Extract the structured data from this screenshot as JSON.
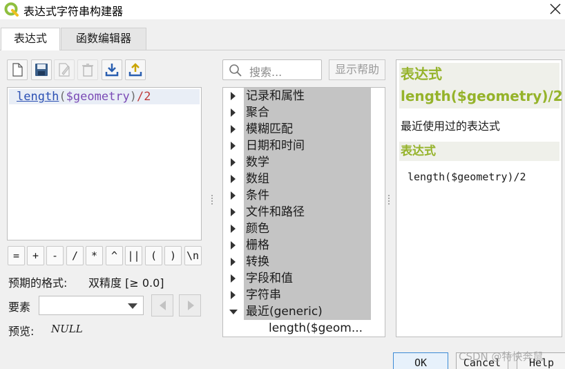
{
  "window": {
    "title": "表达式字符串构建器"
  },
  "tabs": [
    {
      "label": "表达式",
      "active": true
    },
    {
      "label": "函数编辑器",
      "active": false
    }
  ],
  "toolbar": {
    "buttons": [
      {
        "name": "new-file-icon"
      },
      {
        "name": "save-icon"
      },
      {
        "name": "edit-icon"
      },
      {
        "name": "delete-icon"
      },
      {
        "name": "import-icon"
      },
      {
        "name": "export-icon"
      }
    ]
  },
  "editor": {
    "tokens": {
      "fn": "length",
      "open": "(",
      "var": "$geometry",
      "close": ")",
      "op": "/2"
    }
  },
  "operators": [
    "=",
    "+",
    "-",
    "/",
    "*",
    "^",
    "||",
    "(",
    ")",
    "\\n'"
  ],
  "output": {
    "label": "预期的格式:",
    "value": "双精度 [≥ 0.0]"
  },
  "feature": {
    "label": "要素",
    "value": ""
  },
  "preview": {
    "label": "预览:",
    "value": "NULL"
  },
  "search": {
    "placeholder": "搜索..."
  },
  "help_button": "显示帮助",
  "tree": {
    "groups": [
      "记录和属性",
      "聚合",
      "模糊匹配",
      "日期和时间",
      "数学",
      "数组",
      "条件",
      "文件和路径",
      "颜色",
      "栅格",
      "转换",
      "字段和值",
      "字符串",
      "最近(generic)"
    ],
    "expanded_child": "length($geom..."
  },
  "help_panel": {
    "title": "表达式",
    "expression": "length($geometry)/2",
    "description": "最近使用过的表达式",
    "section_title": "表达式",
    "example": "length($geometry)/2"
  },
  "dialog_buttons": {
    "ok": "OK",
    "cancel": "Cancel",
    "help": "Help"
  },
  "watermark": "CSDN @特快奔鼠",
  "colors": {
    "accent_green": "#95b32a",
    "selection_gray": "#c4c4c4"
  }
}
